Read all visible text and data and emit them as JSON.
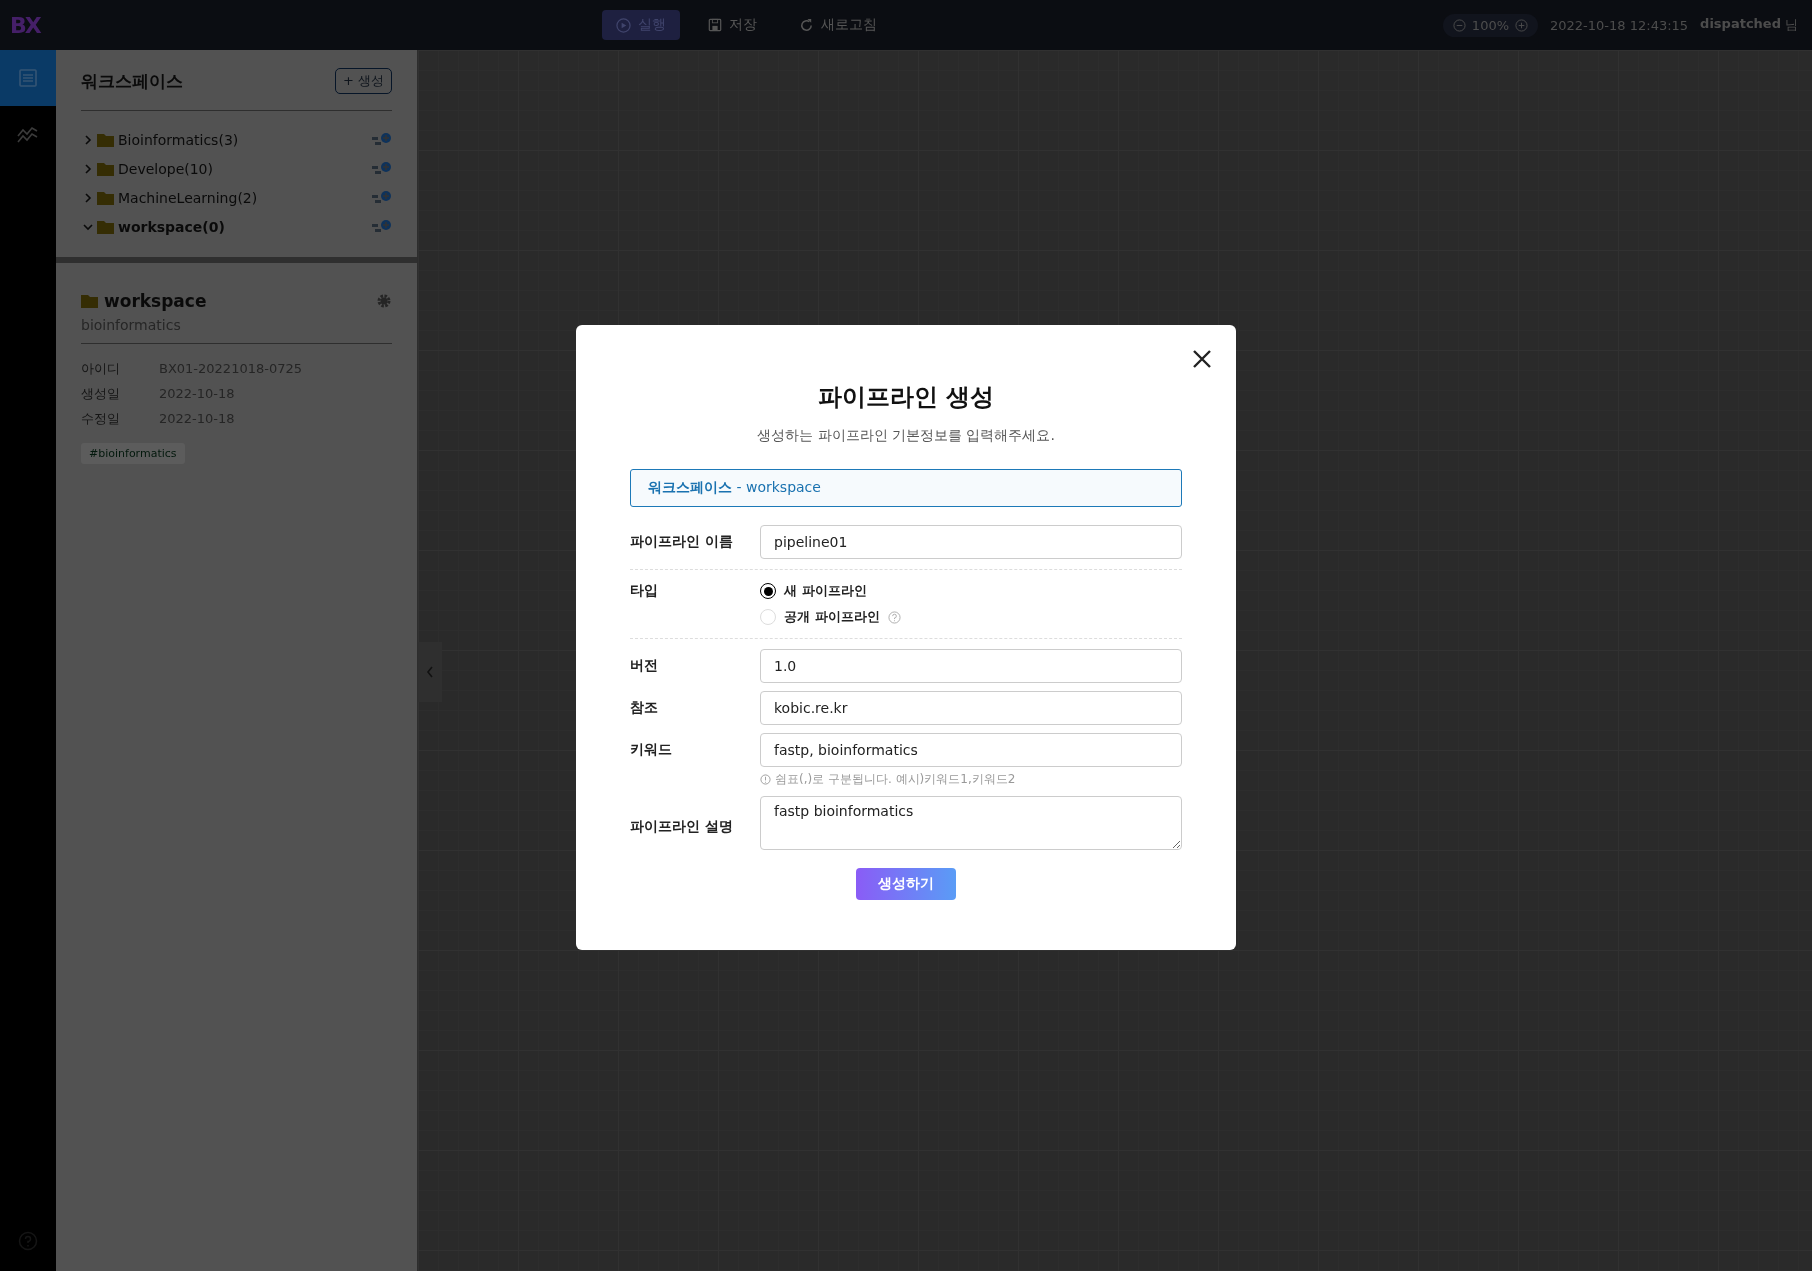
{
  "topbar": {
    "logo": "BX",
    "actions": [
      {
        "label": "실행",
        "kind": "run",
        "selected": true
      },
      {
        "label": "저장",
        "kind": "save",
        "selected": false
      },
      {
        "label": "새로고침",
        "kind": "refresh",
        "selected": false
      }
    ],
    "zoom": "100%",
    "datetime": "2022-10-18 12:43:15",
    "user": "dispatched",
    "honorific": "님"
  },
  "rail": {
    "items": [
      {
        "kind": "document",
        "selected": true
      },
      {
        "kind": "chart",
        "selected": false
      }
    ]
  },
  "sidebar": {
    "title": "워크스페이스",
    "create_button": "+ 생성",
    "tree": [
      {
        "label": "Bioinformatics(3)",
        "expanded": false
      },
      {
        "label": "Develope(10)",
        "expanded": false
      },
      {
        "label": "MachineLearning(2)",
        "expanded": false
      },
      {
        "label": "workspace(0)",
        "expanded": true
      }
    ],
    "detail": {
      "name": "workspace",
      "description": "bioinformatics",
      "fields": [
        {
          "label": "아이디",
          "value": "BX01-20221018-0725"
        },
        {
          "label": "생성일",
          "value": "2022-10-18"
        },
        {
          "label": "수정일",
          "value": "2022-10-18"
        }
      ],
      "tag": "#bioinformatics"
    }
  },
  "modal": {
    "title": "파이프라인 생성",
    "subtitle": "생성하는 파이프라인 기본정보를 입력해주세요.",
    "workspace": "**워크스페이스** - workspace",
    "fields": [
      {
        "kind": "text",
        "label": "파이프라인 이름",
        "value": "pipeline01"
      },
      {
        "kind": "radio",
        "label": "타입",
        "options": [
          {
            "label": "새 파이프라인",
            "selected": true,
            "help": false
          },
          {
            "label": "공개 파이프라인",
            "selected": false,
            "help": true
          }
        ]
      },
      {
        "kind": "text",
        "label": "버전",
        "value": "1.0"
      },
      {
        "kind": "text",
        "label": "참조",
        "value": "kobic.re.kr"
      },
      {
        "kind": "text",
        "label": "키워드",
        "value": "fastp, bioinformatics",
        "hint": "쉼표(,)로 구분됩니다. 예시)키워드1,키워드2"
      },
      {
        "kind": "textarea",
        "label": "파이프라인 설명",
        "value": "fastp bioinformatics"
      }
    ],
    "submit": "생성하기"
  }
}
